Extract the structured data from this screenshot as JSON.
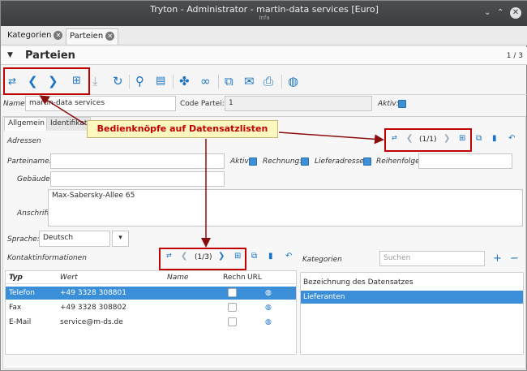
{
  "window": {
    "title": "Tryton - Administrator - martin-data services [Euro]",
    "subtitle": "Infa"
  },
  "tabs": [
    {
      "label": "Kategorien"
    },
    {
      "label": "Parteien"
    }
  ],
  "header": {
    "title": "Parteien",
    "counter": "1 / 3"
  },
  "form": {
    "name_label": "Name:",
    "name_value": "martin-data services",
    "code_label": "Code Partei:",
    "code_value": "1",
    "active_label": "Aktiv:"
  },
  "notebook": {
    "tabs": [
      "Allgemein",
      "Identifikat"
    ]
  },
  "callout": "Bedienknöpfe auf Datensatzlisten",
  "addresses": {
    "title": "Adressen",
    "counter": "(1/1)",
    "party_name_label": "Parteiname:",
    "active_label": "Aktiv:",
    "invoice_label": "Rechnung:",
    "delivery_label": "Lieferadresse:",
    "sequence_label": "Reihenfolge:",
    "building_label": "Gebäude:",
    "address_label": "Anschrift:",
    "address_value": "Max-Sabersky-Allee 65"
  },
  "language": {
    "label": "Sprache:",
    "value": "Deutsch"
  },
  "contacts": {
    "title": "Kontaktinformationen",
    "counter": "(1/3)",
    "columns": [
      "Typ",
      "Wert",
      "Name",
      "Rechn",
      "URL"
    ],
    "rows": [
      {
        "type": "Telefon",
        "value": "+49 3328 308801"
      },
      {
        "type": "Fax",
        "value": "+49 3328 308802"
      },
      {
        "type": "E-Mail",
        "value": "service@m-ds.de"
      }
    ]
  },
  "categories": {
    "title": "Kategorien",
    "search_placeholder": "Suchen",
    "column": "Bezeichnung des Datensatzes",
    "rows": [
      "Lieferanten"
    ]
  },
  "colors": {
    "accent": "#1b74c5",
    "selection": "#3a8fd8",
    "highlight": "#c00000"
  }
}
